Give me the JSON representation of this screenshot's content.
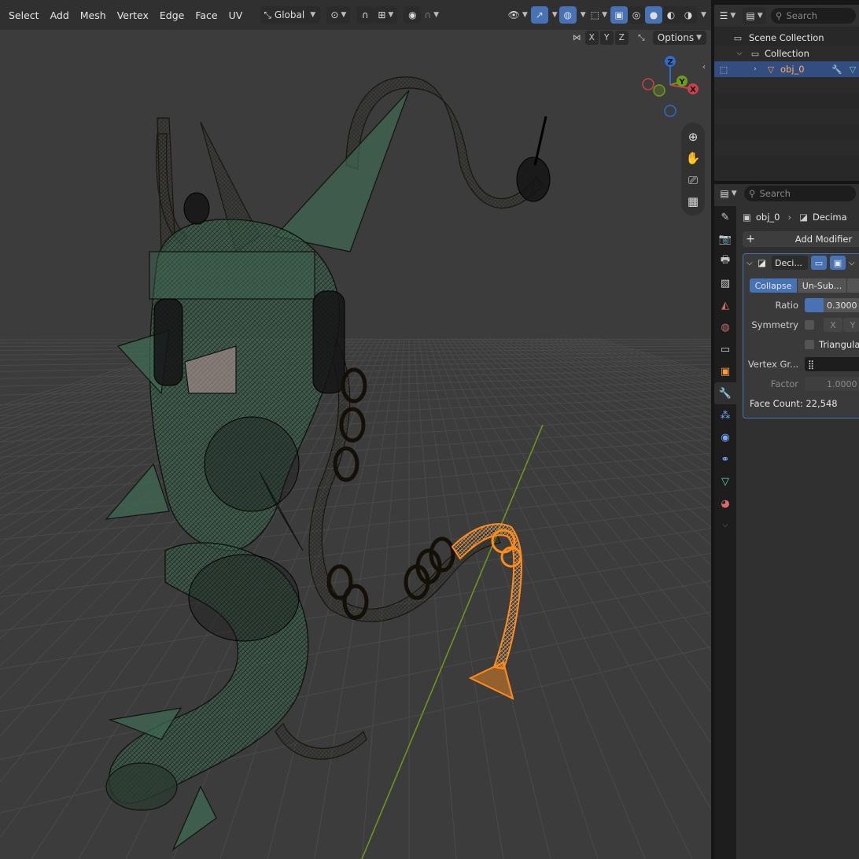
{
  "viewport": {
    "menu": [
      "Select",
      "Add",
      "Mesh",
      "Vertex",
      "Edge",
      "Face",
      "UV"
    ],
    "transform_orientation": "Global",
    "options_label": "Options",
    "axes": [
      "X",
      "Y",
      "Z"
    ],
    "gizmo_axes": {
      "z": "Z",
      "y": "Y",
      "x": "X"
    },
    "colors": {
      "background": "#3c3c3c",
      "grid": "#4a4a4a",
      "x_axis": "#c8414b",
      "y_axis": "#6f9a1a",
      "z_axis": "#2d6cc8",
      "mesh_green": "#3f6b54",
      "mesh_tan": "#a89565",
      "selected": "#ff8c1a"
    }
  },
  "outliner": {
    "search_placeholder": "Search",
    "scene_collection": "Scene Collection",
    "collection": "Collection",
    "object": "obj_0"
  },
  "properties": {
    "search_placeholder": "Search",
    "breadcrumb": {
      "object": "obj_0",
      "modifier": "Decima"
    },
    "add_modifier": "Add Modifier",
    "modifier": {
      "name": "Deci...",
      "modes": [
        "Collapse",
        "Un-Sub..."
      ],
      "active_mode": "Collapse",
      "ratio_label": "Ratio",
      "ratio_value": "0.3000",
      "ratio_fraction": 0.3,
      "symmetry_label": "Symmetry",
      "symmetry_axes": [
        "X",
        "Y"
      ],
      "triangulate_label": "Triangulat",
      "vertex_group_label": "Vertex Gr...",
      "factor_label": "Factor",
      "factor_value": "1.0000",
      "face_count_label": "Face Count: 22,548"
    }
  }
}
